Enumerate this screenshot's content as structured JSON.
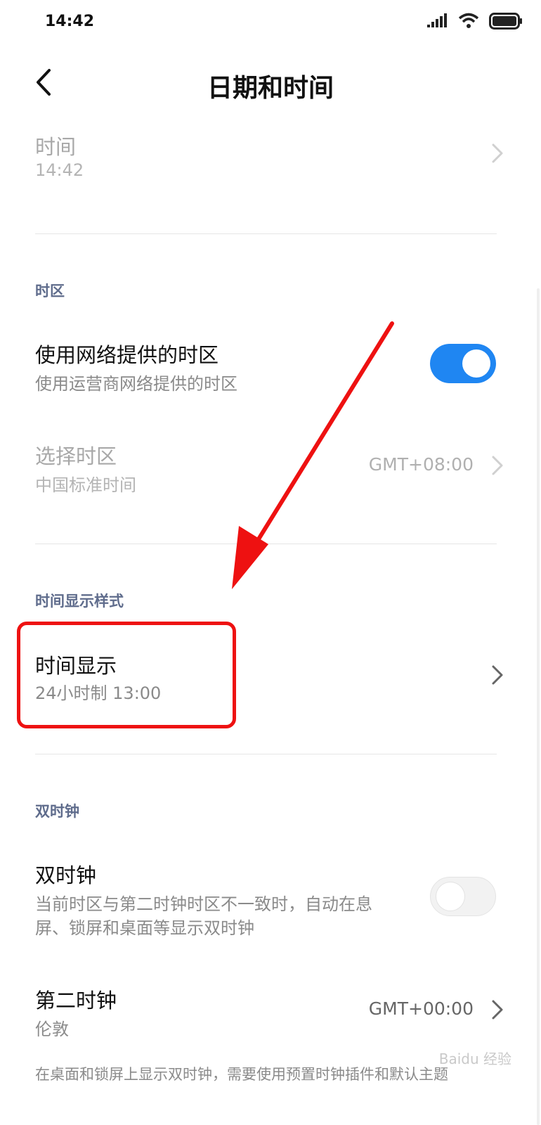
{
  "status_bar": {
    "time": "14:42"
  },
  "header": {
    "title": "日期和时间"
  },
  "rows": {
    "time": {
      "title": "时间",
      "subtitle": "14:42"
    },
    "network_timezone": {
      "title": "使用网络提供的时区",
      "subtitle": "使用运营商网络提供的时区",
      "toggle": "on"
    },
    "select_timezone": {
      "title": "选择时区",
      "subtitle": "中国标准时间",
      "value": "GMT+08:00"
    },
    "time_display": {
      "title": "时间显示",
      "subtitle": "24小时制 13:00"
    },
    "dual_clock": {
      "title": "双时钟",
      "subtitle_line1": "当前时区与第二时钟时区不一致时，自动在息",
      "subtitle_line2": "屏、锁屏和桌面等显示双时钟",
      "toggle": "off"
    },
    "second_clock": {
      "title": "第二时钟",
      "subtitle": "伦敦",
      "value": "GMT+00:00"
    }
  },
  "sections": {
    "timezone": "时区",
    "time_display_style": "时间显示样式",
    "dual_clock": "双时钟"
  },
  "footer": {
    "note": "在桌面和锁屏上显示双时钟，需要使用预置时钟插件和默认主题"
  },
  "watermark": "Baidu 经验",
  "colors": {
    "accent": "#1f86f2",
    "annotation": "#ee1111",
    "section_header": "#5f6c8c"
  }
}
